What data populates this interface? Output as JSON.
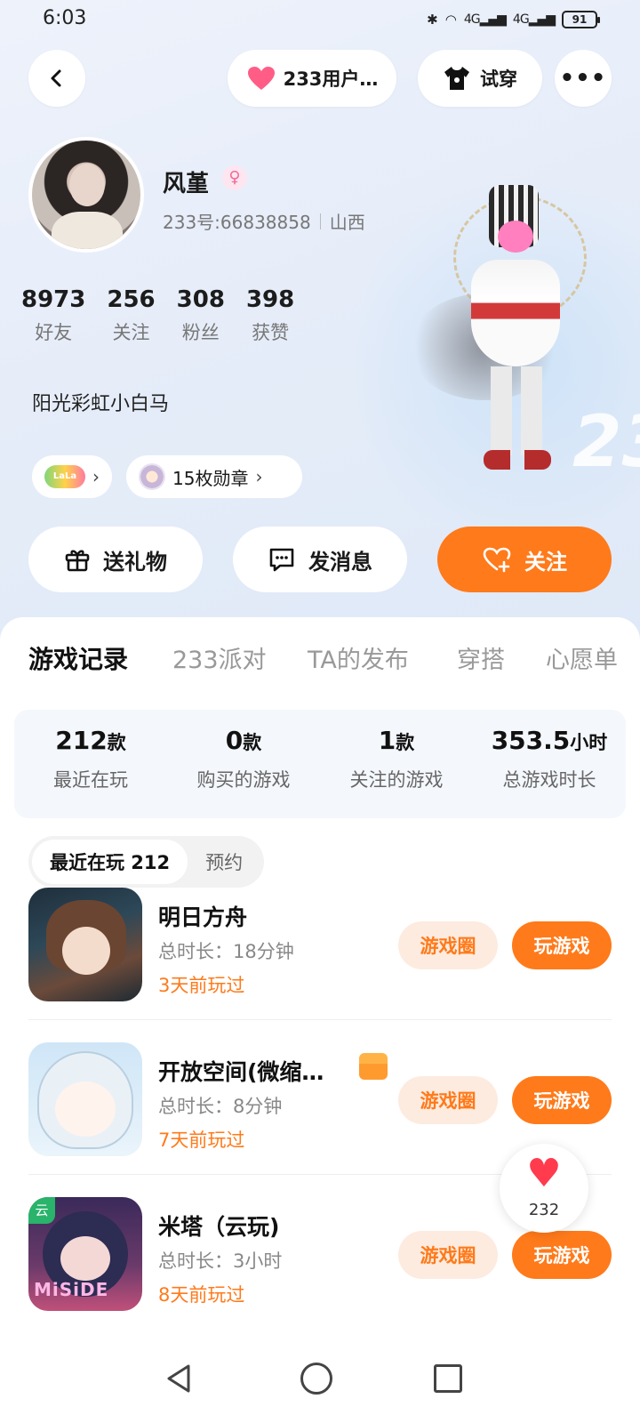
{
  "status": {
    "time": "6:03",
    "network": "4G",
    "battery": "91"
  },
  "topbar": {
    "fans_label": "233用户…",
    "try_label": "试穿"
  },
  "profile": {
    "name": "风堇",
    "id_text": "233号:66838858",
    "region": "山西",
    "bio": "阳光彩虹小白马",
    "medals": "15枚勋章"
  },
  "stats": [
    {
      "num": "8973",
      "label": "好友"
    },
    {
      "num": "256",
      "label": "关注"
    },
    {
      "num": "308",
      "label": "粉丝"
    },
    {
      "num": "398",
      "label": "获赞"
    }
  ],
  "actions": {
    "gift": "送礼物",
    "message": "发消息",
    "follow": "关注"
  },
  "tabs": [
    "游戏记录",
    "233派对",
    "TA的发布",
    "穿搭",
    "心愿单"
  ],
  "summary": [
    {
      "value": "212",
      "unit": "款",
      "label": "最近在玩"
    },
    {
      "value": "0",
      "unit": "款",
      "label": "购买的游戏"
    },
    {
      "value": "1",
      "unit": "款",
      "label": "关注的游戏"
    },
    {
      "value": "353.5",
      "unit": "小时",
      "label": "总游戏时长"
    }
  ],
  "subtabs": {
    "recent": "最近在玩 212",
    "reserve": "预约"
  },
  "games": [
    {
      "name": "明日方舟",
      "duration": "总时长：18分钟",
      "last": "3天前玩过",
      "circle": "游戏圈",
      "play": "玩游戏"
    },
    {
      "name": "开放空间(微缩…",
      "duration": "总时长：8分钟",
      "last": "7天前玩过",
      "circle": "游戏圈",
      "play": "玩游戏"
    },
    {
      "name": "米塔（云玩)",
      "duration": "总时长：3小时",
      "last": "8天前玩过",
      "circle": "游戏圈",
      "play": "玩游戏"
    }
  ],
  "game_icon_text": {
    "cloud_tag": "云",
    "mita_brand": "MiSiDE"
  },
  "floating_like": {
    "count": "232"
  },
  "colors": {
    "accent": "#ff7a1a",
    "heart": "#ff3b4d"
  }
}
